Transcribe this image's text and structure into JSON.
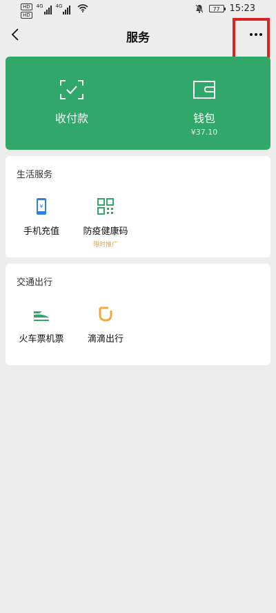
{
  "status_bar": {
    "sim1_badge": "HD",
    "sim2_badge": "HD",
    "network1": "4G",
    "network2": "4G",
    "battery": "77",
    "time": "15:23"
  },
  "header": {
    "title": "服务"
  },
  "wallet_card": {
    "pay_label": "收付款",
    "wallet_label": "钱包",
    "wallet_balance": "¥37.10",
    "color": "#31a86a"
  },
  "life_section": {
    "title": "生活服务",
    "items": [
      {
        "label": "手机充值",
        "sub": ""
      },
      {
        "label": "防疫健康码",
        "sub": "限时推广"
      }
    ]
  },
  "travel_section": {
    "title": "交通出行",
    "items": [
      {
        "label": "火车票机票"
      },
      {
        "label": "滴滴出行"
      }
    ]
  },
  "colors": {
    "accent_green": "#31a86a",
    "promo_orange": "#e3a23b",
    "highlight_red": "#e02020",
    "phone_blue": "#2f80ed",
    "didi_orange": "#f2a83b"
  }
}
